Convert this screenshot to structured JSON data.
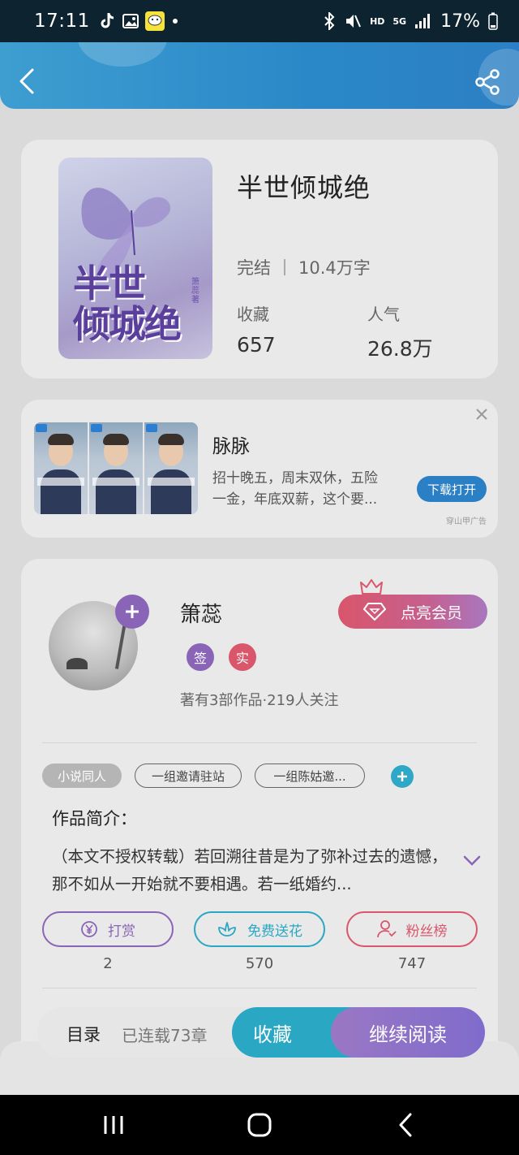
{
  "status_bar": {
    "time": "17:11",
    "network_label": "HD",
    "signal_label": "5G",
    "battery": "17%"
  },
  "header": {
    "back_icon": "chevron-left-icon",
    "share_icon": "share-icon"
  },
  "book": {
    "title": "半世倾城绝",
    "cover_title": "半世\n倾城绝",
    "cover_author": "箫蕊 著",
    "status": "完结",
    "word_count": "10.4万字",
    "collect_label": "收藏",
    "collect_value": "657",
    "popularity_label": "人气",
    "popularity_value": "26.8万"
  },
  "ad": {
    "app_name": "脉脉",
    "description": "招十晚五，周末双休，五险一金，年底双薪，这个要...",
    "button_label": "下载打开",
    "source": "穿山甲广告"
  },
  "author": {
    "name": "箫蕊",
    "badge_sign": "签",
    "badge_real": "实",
    "stats": "著有3部作品·219人关注",
    "vip_button": "点亮会员",
    "colors": {
      "sign_badge": "#8a64b6",
      "real_badge": "#d9566b"
    }
  },
  "tags": [
    {
      "label": "小说同人"
    },
    {
      "label": "一组邀请驻站"
    },
    {
      "label": "一组陈姑邀..."
    }
  ],
  "intro": {
    "label": "作品简介：",
    "text": "（本文不授权转载）若回溯往昔是为了弥补过去的遗憾，那不如从一开始就不要相遇。若一纸婚约..."
  },
  "actions": [
    {
      "label": "打赏",
      "count": "2",
      "color": "#8a64b6"
    },
    {
      "label": "免费送花",
      "count": "570",
      "color": "#2aa7c3"
    },
    {
      "label": "粉丝榜",
      "count": "747",
      "color": "#d9566b"
    }
  ],
  "bottom_bar": {
    "catalog": "目录",
    "chapters": "已连载73章",
    "collect": "收藏",
    "continue_read": "继续阅读"
  }
}
